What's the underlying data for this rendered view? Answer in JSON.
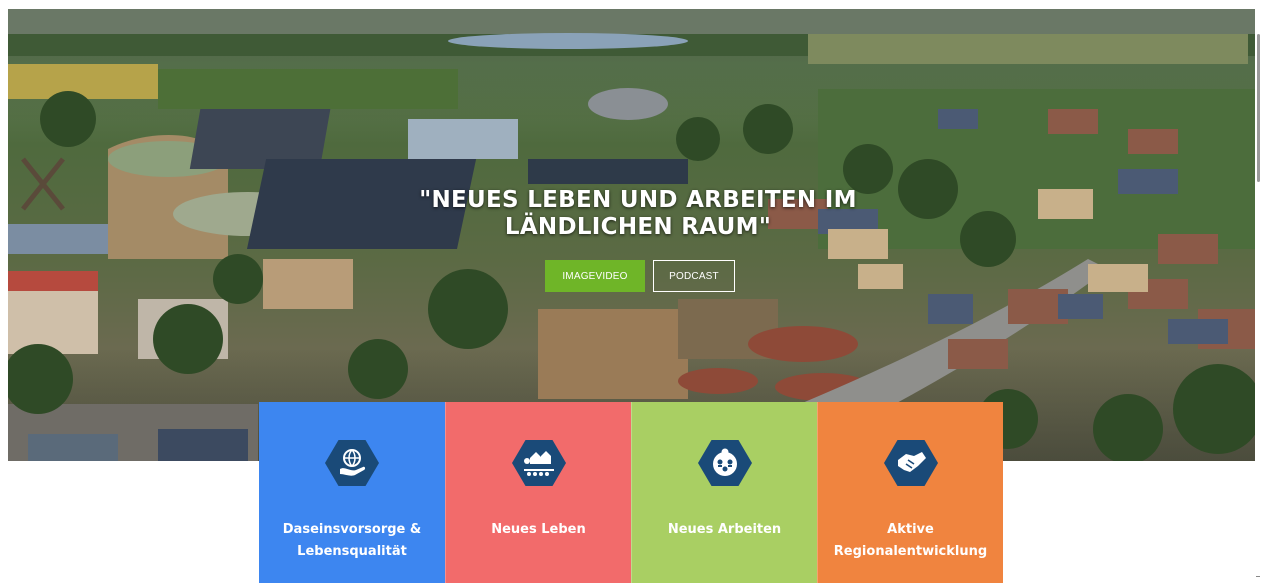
{
  "hero": {
    "title_line1": "\"NEUES LEBEN UND ARBEITEN IM",
    "title_line2": "LÄNDLICHEN RAUM\"",
    "buttons": {
      "imagevideo": "IMAGEVIDEO",
      "podcast": "PODCAST"
    },
    "colors": {
      "imagevideo_bg": "#6fb528",
      "podcast_border": "#ffffff"
    }
  },
  "tiles": [
    {
      "line1": "Daseinsvorsorge &",
      "line2": "Lebensqualität",
      "color": "#3d86f0",
      "icon": "globe-hand-icon"
    },
    {
      "line1": "Neues Leben",
      "line2": "",
      "color": "#f26b6b",
      "icon": "village-icon"
    },
    {
      "line1": "Neues Arbeiten",
      "line2": "",
      "color": "#a9cf63",
      "icon": "team-meeting-icon"
    },
    {
      "line1": "Aktive",
      "line2": "Regionalentwicklung",
      "color": "#f0843f",
      "icon": "handshake-icon"
    }
  ],
  "colors": {
    "hex_icon_bg": "#1a4a78"
  }
}
